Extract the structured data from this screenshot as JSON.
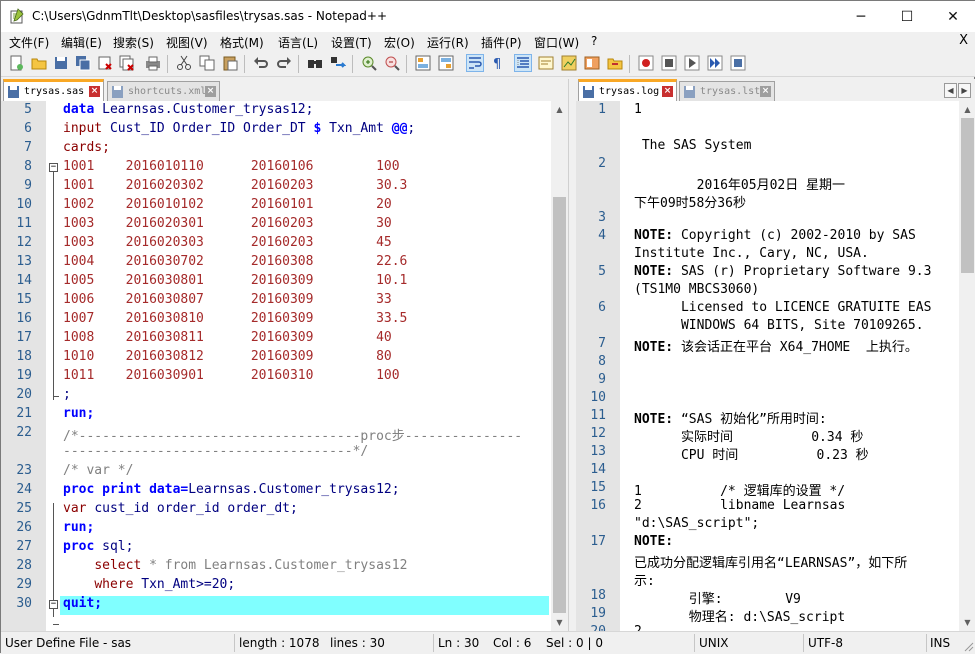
{
  "window": {
    "title": "C:\\Users\\GdnmTlt\\Desktop\\sasfiles\\trysas.sas - Notepad++",
    "min_symbol": "─",
    "max_symbol": "☐",
    "close_symbol": "✕"
  },
  "menu": {
    "items": [
      "文件(F)",
      "编辑(E)",
      "搜索(S)",
      "视图(V)",
      "格式(M)",
      "语言(L)",
      "设置(T)",
      "宏(O)",
      "运行(R)",
      "插件(P)",
      "窗口(W)",
      "?"
    ],
    "close_doc": "X"
  },
  "left_pane": {
    "tabs": [
      {
        "label": "trysas.sas",
        "active": true
      },
      {
        "label": "shortcuts.xml",
        "active": false
      }
    ],
    "lines": [
      {
        "n": "5",
        "segs": [
          [
            "kw",
            "data "
          ],
          [
            "plain",
            "Learnsas.Customer_trysas12;"
          ]
        ]
      },
      {
        "n": "6",
        "segs": [
          [
            "str",
            "input "
          ],
          [
            "plain",
            "Cust_ID Order_ID Order_DT "
          ],
          [
            "kw",
            "$ "
          ],
          [
            "plain",
            "Txn_Amt "
          ],
          [
            "kw",
            "@@"
          ],
          [
            "plain",
            ";"
          ]
        ]
      },
      {
        "n": "7",
        "segs": [
          [
            "str",
            "cards;"
          ]
        ]
      },
      {
        "n": "8",
        "segs": [
          [
            "red",
            "1001    2016010110      20160106        100"
          ]
        ]
      },
      {
        "n": "9",
        "segs": [
          [
            "red",
            "1001    2016020302      20160203        30.3"
          ]
        ]
      },
      {
        "n": "10",
        "segs": [
          [
            "red",
            "1002    2016010102      20160101        20"
          ]
        ]
      },
      {
        "n": "11",
        "segs": [
          [
            "red",
            "1003    2016020301      20160203        30"
          ]
        ]
      },
      {
        "n": "12",
        "segs": [
          [
            "red",
            "1003    2016020303      20160203        45"
          ]
        ]
      },
      {
        "n": "13",
        "segs": [
          [
            "red",
            "1004    2016030702      20160308        22.6"
          ]
        ]
      },
      {
        "n": "14",
        "segs": [
          [
            "red",
            "1005    2016030801      20160309        10.1"
          ]
        ]
      },
      {
        "n": "15",
        "segs": [
          [
            "red",
            "1006    2016030807      20160309        33"
          ]
        ]
      },
      {
        "n": "16",
        "segs": [
          [
            "red",
            "1007    2016030810      20160309        33.5"
          ]
        ]
      },
      {
        "n": "17",
        "segs": [
          [
            "red",
            "1008    2016030811      20160309        40"
          ]
        ]
      },
      {
        "n": "18",
        "segs": [
          [
            "red",
            "1010    2016030812      20160309        80"
          ]
        ]
      },
      {
        "n": "19",
        "segs": [
          [
            "red",
            "1011    2016030901      20160310        100"
          ]
        ]
      },
      {
        "n": "20",
        "segs": [
          [
            "plain",
            ";"
          ]
        ]
      },
      {
        "n": "21",
        "segs": [
          [
            "kw",
            "run;"
          ]
        ]
      },
      {
        "n": "22",
        "segs": [
          [
            "cmt",
            "/*------------------------------------proc步---------------"
          ]
        ]
      },
      {
        "n": "",
        "segs": [
          [
            "cmt",
            "-------------------------------------*/"
          ]
        ]
      },
      {
        "n": "23",
        "segs": [
          [
            "cmt",
            "/* var */"
          ]
        ]
      },
      {
        "n": "24",
        "segs": [
          [
            "kw",
            "proc print "
          ],
          [
            "kw",
            "data="
          ],
          [
            "plain",
            "Learnsas.Customer_trysas12;"
          ]
        ]
      },
      {
        "n": "25",
        "segs": [
          [
            "str",
            "var "
          ],
          [
            "plain",
            "cust_id order_id order_dt;"
          ]
        ]
      },
      {
        "n": "26",
        "segs": [
          [
            "kw",
            "run;"
          ]
        ]
      },
      {
        "n": "27",
        "segs": [
          [
            "kw",
            "proc "
          ],
          [
            "plain",
            "sql;"
          ]
        ]
      },
      {
        "n": "28",
        "segs": [
          [
            "plain",
            "    "
          ],
          [
            "str",
            "select "
          ],
          [
            "cmt",
            "* from Learnsas.Customer_trysas12"
          ]
        ]
      },
      {
        "n": "29",
        "segs": [
          [
            "plain",
            "    "
          ],
          [
            "str",
            "where "
          ],
          [
            "plain",
            "Txn_Amt>=20;"
          ]
        ]
      },
      {
        "n": "30",
        "segs": [
          [
            "kw",
            "quit;"
          ]
        ]
      }
    ]
  },
  "right_pane": {
    "tabs": [
      {
        "label": "trysas.log",
        "active": true
      },
      {
        "label": "trysas.lst",
        "active": false
      }
    ],
    "lines": [
      {
        "n": "1",
        "segs": [
          [
            "n",
            "1"
          ]
        ]
      },
      {
        "n": "",
        "segs": [
          [
            "n",
            ""
          ]
        ]
      },
      {
        "n": "",
        "segs": [
          [
            "n",
            " The SAS System"
          ]
        ]
      },
      {
        "n": "2",
        "segs": [
          [
            "n",
            ""
          ]
        ]
      },
      {
        "n": "",
        "segs": [
          [
            "n",
            "        2016年05月02日 星期一"
          ]
        ]
      },
      {
        "n": "",
        "segs": [
          [
            "n",
            "下午09时58分36秒"
          ]
        ]
      },
      {
        "n": "3",
        "segs": [
          [
            "n",
            ""
          ]
        ]
      },
      {
        "n": "4",
        "segs": [
          [
            "b",
            "NOTE: "
          ],
          [
            "n",
            "Copyright (c) 2002-2010 by SAS"
          ]
        ]
      },
      {
        "n": "",
        "segs": [
          [
            "n",
            "Institute Inc., Cary, NC, USA."
          ]
        ]
      },
      {
        "n": "5",
        "segs": [
          [
            "b",
            "NOTE: "
          ],
          [
            "n",
            "SAS (r) Proprietary Software 9.3"
          ]
        ]
      },
      {
        "n": "",
        "segs": [
          [
            "n",
            "(TS1M0 MBCS3060)"
          ]
        ]
      },
      {
        "n": "6",
        "segs": [
          [
            "n",
            "      Licensed to LICENCE GRATUITE EAS"
          ]
        ]
      },
      {
        "n": "",
        "segs": [
          [
            "n",
            "      WINDOWS 64 BITS, Site 70109265."
          ]
        ]
      },
      {
        "n": "7",
        "segs": [
          [
            "b",
            "NOTE: "
          ],
          [
            "n",
            "该会话正在平台 X64_7HOME  上执行。"
          ]
        ]
      },
      {
        "n": "8",
        "segs": [
          [
            "n",
            ""
          ]
        ]
      },
      {
        "n": "9",
        "segs": [
          [
            "n",
            ""
          ]
        ]
      },
      {
        "n": "10",
        "segs": [
          [
            "n",
            ""
          ]
        ]
      },
      {
        "n": "11",
        "segs": [
          [
            "b",
            "NOTE: "
          ],
          [
            "n",
            "“SAS 初始化”所用时间:"
          ]
        ]
      },
      {
        "n": "12",
        "segs": [
          [
            "n",
            "      实际时间          0.34 秒"
          ]
        ]
      },
      {
        "n": "13",
        "segs": [
          [
            "n",
            "      CPU 时间          0.23 秒"
          ]
        ]
      },
      {
        "n": "14",
        "segs": [
          [
            "n",
            ""
          ]
        ]
      },
      {
        "n": "15",
        "segs": [
          [
            "n",
            "1          /* 逻辑库的设置 */"
          ]
        ]
      },
      {
        "n": "16",
        "segs": [
          [
            "n",
            "2          libname Learnsas"
          ]
        ]
      },
      {
        "n": "",
        "segs": [
          [
            "n",
            "\"d:\\SAS_script\";"
          ]
        ]
      },
      {
        "n": "17",
        "segs": [
          [
            "b",
            "NOTE:"
          ]
        ]
      },
      {
        "n": "",
        "segs": [
          [
            "n",
            "已成功分配逻辑库引用名“LEARNSAS”，如下所"
          ]
        ]
      },
      {
        "n": "",
        "segs": [
          [
            "n",
            "示:"
          ]
        ]
      },
      {
        "n": "18",
        "segs": [
          [
            "n",
            "       引擎:        V9"
          ]
        ]
      },
      {
        "n": "19",
        "segs": [
          [
            "n",
            "       物理名: d:\\SAS_script"
          ]
        ]
      },
      {
        "n": "20",
        "segs": [
          [
            "n",
            "2"
          ]
        ]
      }
    ]
  },
  "status": {
    "file_type": "User Define File - sas",
    "length": "length : 1078",
    "lines": "lines : 30",
    "ln": "Ln : 30",
    "col": "Col : 6",
    "sel": "Sel : 0 | 0",
    "eol": "UNIX",
    "encoding": "UTF-8",
    "mode": "INS"
  },
  "colors": {
    "caret_line": "#80ffff",
    "active_tab_accent": "#f9a825"
  }
}
